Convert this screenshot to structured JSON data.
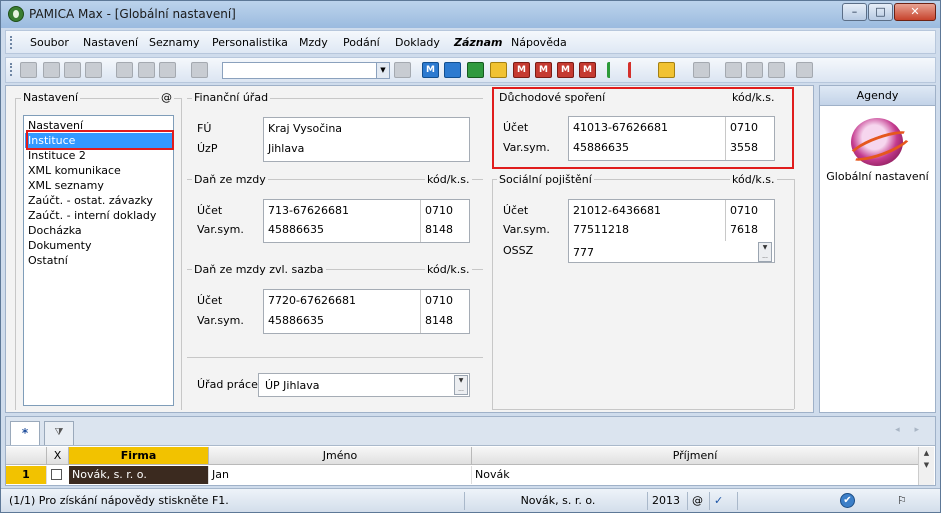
{
  "window": {
    "title": "PAMICA Max - [Globální nastavení]",
    "minimize_glyph": "–",
    "maximize_glyph": "□",
    "close_glyph": "✕"
  },
  "menu": [
    "Soubor",
    "Nastavení",
    "Seznamy",
    "Personalistika",
    "Mzdy",
    "Podání",
    "Doklady",
    "Záznam",
    "Nápověda"
  ],
  "toolbar": {
    "combo_value": "",
    "m_glyph": "M",
    "icons": [
      "open-icon",
      "copy-icon",
      "print-icon",
      "preview-icon",
      "new-document-icon",
      "save-icon",
      "save-as-icon",
      "clipboard-icon",
      "filter-icon",
      "m-blue-icon",
      "person-up-icon",
      "person-green-icon",
      "accessibility-icon",
      "m-red-icon",
      "green-flag-icon",
      "red-flag-icon",
      "folder-icon",
      "calculator-icon",
      "comment-icon",
      "list-icon",
      "card-icon",
      "check-icon",
      "help-icon"
    ]
  },
  "left_panel": {
    "title": "Nastavení",
    "at_symbol": "@",
    "items": [
      "Nastavení",
      "Instituce",
      "Instituce 2",
      "XML komunikace",
      "XML seznamy",
      "Zaúčt. - ostat. závazky",
      "Zaúčt. - interní doklady",
      "Docházka",
      "Dokumenty",
      "Ostatní"
    ],
    "selected_index": 1
  },
  "financni_urad": {
    "title": "Finanční úřad",
    "fu_label": "FÚ",
    "fu_value": "Kraj Vysočina",
    "uzp_label": "ÚzP",
    "uzp_value": "Jihlava"
  },
  "dan_ze_mzdy": {
    "title": "Daň ze mzdy",
    "kod_label": "kód/k.s.",
    "ucet_label": "Účet",
    "ucet_value": "713-67626681",
    "ucet_kod": "0710",
    "varsym_label": "Var.sym.",
    "varsym_value": "45886635",
    "varsym_kod": "8148"
  },
  "dan_zvl": {
    "title": "Daň ze mzdy zvl. sazba",
    "kod_label": "kód/k.s.",
    "ucet_label": "Účet",
    "ucet_value": "7720-67626681",
    "ucet_kod": "0710",
    "varsym_label": "Var.sym.",
    "varsym_value": "45886635",
    "varsym_kod": "8148"
  },
  "urad_prace": {
    "label": "Úřad práce",
    "value": "ÚP Jihlava"
  },
  "duchodove": {
    "title": "Důchodové spoření",
    "kod_label": "kód/k.s.",
    "ucet_label": "Účet",
    "ucet_value": "41013-67626681",
    "ucet_kod": "0710",
    "varsym_label": "Var.sym.",
    "varsym_value": "45886635",
    "varsym_kod": "3558"
  },
  "socialni": {
    "title": "Sociální pojištění",
    "kod_label": "kód/k.s.",
    "ucet_label": "Účet",
    "ucet_value": "21012-6436681",
    "ucet_kod": "0710",
    "varsym_label": "Var.sym.",
    "varsym_value": "77511218",
    "varsym_kod": "7618",
    "ossz_label": "OSSZ",
    "ossz_value": "777"
  },
  "agendy": {
    "title": "Agendy",
    "item_label": "Globální nastavení"
  },
  "grid": {
    "tab_all": "*",
    "tab_filter_glyph": "⧩",
    "nav_glyphs": "◂ ▸",
    "scroll_up_glyph": "▲",
    "scroll_down_glyph": "▼",
    "spin_glyph": "▼",
    "spin_more_glyph": "...",
    "columns": [
      "X",
      "Firma",
      "Jméno",
      "Příjmení"
    ],
    "rows": [
      {
        "num": "1",
        "firma": "Novák, s. r. o.",
        "jmeno": "Jan",
        "prijmeni": "Novák"
      }
    ]
  },
  "status": {
    "hint": "(1/1) Pro získání nápovědy stiskněte F1.",
    "company": "Novák, s. r. o.",
    "year": "2013",
    "at": "@",
    "check_glyph": "✓",
    "ok_glyph": "✔",
    "flag_glyph": "⚐"
  }
}
